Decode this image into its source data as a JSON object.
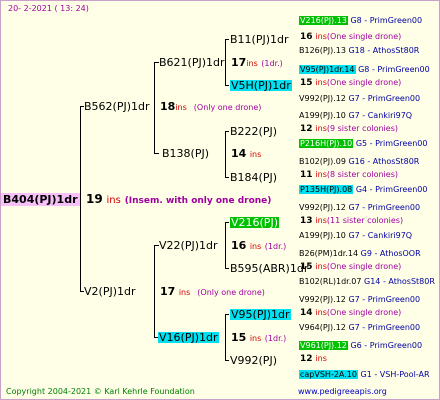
{
  "header": "20-   2-2021  ( 13:  24)",
  "root": {
    "name": "B404(PJ)1dr",
    "ins_count": "19",
    "ins_word": "ins",
    "note": "(Insem. with only one drone)"
  },
  "gen1": [
    {
      "name": "B562(PJ)1dr",
      "ins_count": "18",
      "ins_word": "ins",
      "note": "(Only one drone)"
    },
    {
      "name": "V2(PJ)1dr",
      "ins_count": "17",
      "ins_word": "ins",
      "note": "(Only one drone)"
    }
  ],
  "gen2": [
    {
      "name": "B621(PJ)1dr",
      "ins_count": "17",
      "ins_word": "ins",
      "note": "(1dr.)"
    },
    {
      "name": "B138(PJ)",
      "ins_count": "14",
      "ins_word": "ins",
      "note": ""
    },
    {
      "name": "V22(PJ)1dr",
      "ins_count": "16",
      "ins_word": "ins",
      "note": "(1dr.)"
    },
    {
      "name": "V16(PJ)1dr",
      "ins_count": "15",
      "ins_word": "ins",
      "note": "(1dr.)"
    }
  ],
  "gen3": [
    {
      "name": "B11(PJ)1dr",
      "ins_count": "16",
      "note": "(One single drone)"
    },
    {
      "name": "V5H(PJ)1dr",
      "ins_count": "15",
      "note": "(One single drone)"
    },
    {
      "name": "B222(PJ)",
      "ins_count": "12",
      "note": "(9 sister colonies)"
    },
    {
      "name": "B184(PJ)",
      "ins_count": "11",
      "note": "(8 sister colonies)"
    },
    {
      "name": "V216(PJ)",
      "ins_count": "13",
      "note": "(11 sister colonies)"
    },
    {
      "name": "B595(ABR)1dr",
      "ins_count": "15",
      "note": "(One single drone)"
    },
    {
      "name": "V95(PJ)1dr",
      "ins_count": "14",
      "note": "(One single drone)"
    },
    {
      "name": "V992(PJ)",
      "ins_count": "12",
      "note": ""
    }
  ],
  "gen4": [
    {
      "name": "V216(PJ).13",
      "info": "G8 - PrimGreen00"
    },
    {
      "name": "B126(PJ).13",
      "info": "G18 - AthosSt80R"
    },
    {
      "name": "V95(PJ)1dr.14",
      "info": "G8 - PrimGreen00"
    },
    {
      "name": "V992(PJ).12",
      "info": "G7 - PrimGreen00"
    },
    {
      "name": "A199(PJ).10",
      "info": "G7 - Cankiri97Q"
    },
    {
      "name": "P216H(PJ).10",
      "info": "G5 - PrimGreen00"
    },
    {
      "name": "B102(PJ).09",
      "info": "G16 - AthosSt80R"
    },
    {
      "name": "P135H(PJ).08",
      "info": "G4 - PrimGreen00"
    },
    {
      "name": "V992(PJ).12",
      "info": "G7 - PrimGreen00"
    },
    {
      "name": "A199(PJ).10",
      "info": "G7 - Cankiri97Q"
    },
    {
      "name": "B26(PM)1dr.14",
      "info": "G9 - AthosOOR"
    },
    {
      "name": "B102(RL)1dr.07",
      "info": "G14 - AthosSt80R"
    },
    {
      "name": "V992(PJ).12",
      "info": "G7 - PrimGreen00"
    },
    {
      "name": "V964(PJ).12",
      "info": "G7 - PrimGreen00"
    },
    {
      "name": "V961(PJ).12",
      "info": "G6 - PrimGreen00"
    },
    {
      "name": "capVSH-2A.10",
      "info": "G1 - VSH-Pool-AR"
    }
  ],
  "ins_word": "ins",
  "footer": {
    "copyright": "Copyright 2004-2021 © Karl Kehrle Foundation",
    "url": "www.pedigreeapis.org"
  }
}
